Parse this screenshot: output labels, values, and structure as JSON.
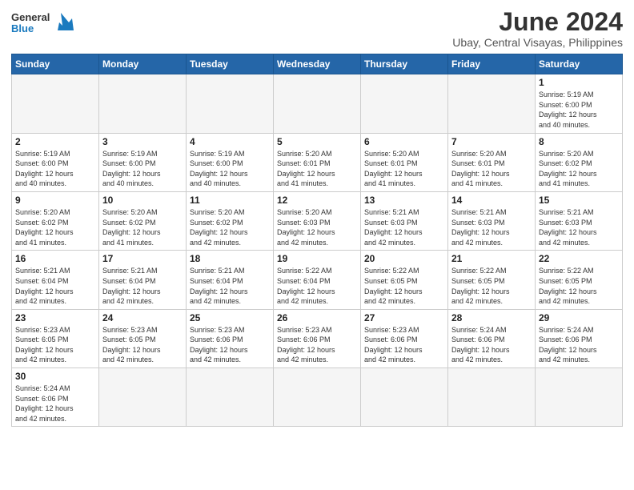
{
  "logo": {
    "text_general": "General",
    "text_blue": "Blue"
  },
  "title": "June 2024",
  "subtitle": "Ubay, Central Visayas, Philippines",
  "days_header": [
    "Sunday",
    "Monday",
    "Tuesday",
    "Wednesday",
    "Thursday",
    "Friday",
    "Saturday"
  ],
  "weeks": [
    [
      {
        "num": "",
        "info": "",
        "empty": true
      },
      {
        "num": "",
        "info": "",
        "empty": true
      },
      {
        "num": "",
        "info": "",
        "empty": true
      },
      {
        "num": "",
        "info": "",
        "empty": true
      },
      {
        "num": "",
        "info": "",
        "empty": true
      },
      {
        "num": "",
        "info": "",
        "empty": true
      },
      {
        "num": "1",
        "info": "Sunrise: 5:19 AM\nSunset: 6:00 PM\nDaylight: 12 hours\nand 40 minutes."
      }
    ],
    [
      {
        "num": "2",
        "info": "Sunrise: 5:19 AM\nSunset: 6:00 PM\nDaylight: 12 hours\nand 40 minutes."
      },
      {
        "num": "3",
        "info": "Sunrise: 5:19 AM\nSunset: 6:00 PM\nDaylight: 12 hours\nand 40 minutes."
      },
      {
        "num": "4",
        "info": "Sunrise: 5:19 AM\nSunset: 6:00 PM\nDaylight: 12 hours\nand 40 minutes."
      },
      {
        "num": "5",
        "info": "Sunrise: 5:20 AM\nSunset: 6:01 PM\nDaylight: 12 hours\nand 41 minutes."
      },
      {
        "num": "6",
        "info": "Sunrise: 5:20 AM\nSunset: 6:01 PM\nDaylight: 12 hours\nand 41 minutes."
      },
      {
        "num": "7",
        "info": "Sunrise: 5:20 AM\nSunset: 6:01 PM\nDaylight: 12 hours\nand 41 minutes."
      },
      {
        "num": "8",
        "info": "Sunrise: 5:20 AM\nSunset: 6:02 PM\nDaylight: 12 hours\nand 41 minutes."
      }
    ],
    [
      {
        "num": "9",
        "info": "Sunrise: 5:20 AM\nSunset: 6:02 PM\nDaylight: 12 hours\nand 41 minutes."
      },
      {
        "num": "10",
        "info": "Sunrise: 5:20 AM\nSunset: 6:02 PM\nDaylight: 12 hours\nand 41 minutes."
      },
      {
        "num": "11",
        "info": "Sunrise: 5:20 AM\nSunset: 6:02 PM\nDaylight: 12 hours\nand 42 minutes."
      },
      {
        "num": "12",
        "info": "Sunrise: 5:20 AM\nSunset: 6:03 PM\nDaylight: 12 hours\nand 42 minutes."
      },
      {
        "num": "13",
        "info": "Sunrise: 5:21 AM\nSunset: 6:03 PM\nDaylight: 12 hours\nand 42 minutes."
      },
      {
        "num": "14",
        "info": "Sunrise: 5:21 AM\nSunset: 6:03 PM\nDaylight: 12 hours\nand 42 minutes."
      },
      {
        "num": "15",
        "info": "Sunrise: 5:21 AM\nSunset: 6:03 PM\nDaylight: 12 hours\nand 42 minutes."
      }
    ],
    [
      {
        "num": "16",
        "info": "Sunrise: 5:21 AM\nSunset: 6:04 PM\nDaylight: 12 hours\nand 42 minutes."
      },
      {
        "num": "17",
        "info": "Sunrise: 5:21 AM\nSunset: 6:04 PM\nDaylight: 12 hours\nand 42 minutes."
      },
      {
        "num": "18",
        "info": "Sunrise: 5:21 AM\nSunset: 6:04 PM\nDaylight: 12 hours\nand 42 minutes."
      },
      {
        "num": "19",
        "info": "Sunrise: 5:22 AM\nSunset: 6:04 PM\nDaylight: 12 hours\nand 42 minutes."
      },
      {
        "num": "20",
        "info": "Sunrise: 5:22 AM\nSunset: 6:05 PM\nDaylight: 12 hours\nand 42 minutes."
      },
      {
        "num": "21",
        "info": "Sunrise: 5:22 AM\nSunset: 6:05 PM\nDaylight: 12 hours\nand 42 minutes."
      },
      {
        "num": "22",
        "info": "Sunrise: 5:22 AM\nSunset: 6:05 PM\nDaylight: 12 hours\nand 42 minutes."
      }
    ],
    [
      {
        "num": "23",
        "info": "Sunrise: 5:23 AM\nSunset: 6:05 PM\nDaylight: 12 hours\nand 42 minutes."
      },
      {
        "num": "24",
        "info": "Sunrise: 5:23 AM\nSunset: 6:05 PM\nDaylight: 12 hours\nand 42 minutes."
      },
      {
        "num": "25",
        "info": "Sunrise: 5:23 AM\nSunset: 6:06 PM\nDaylight: 12 hours\nand 42 minutes."
      },
      {
        "num": "26",
        "info": "Sunrise: 5:23 AM\nSunset: 6:06 PM\nDaylight: 12 hours\nand 42 minutes."
      },
      {
        "num": "27",
        "info": "Sunrise: 5:23 AM\nSunset: 6:06 PM\nDaylight: 12 hours\nand 42 minutes."
      },
      {
        "num": "28",
        "info": "Sunrise: 5:24 AM\nSunset: 6:06 PM\nDaylight: 12 hours\nand 42 minutes."
      },
      {
        "num": "29",
        "info": "Sunrise: 5:24 AM\nSunset: 6:06 PM\nDaylight: 12 hours\nand 42 minutes."
      }
    ],
    [
      {
        "num": "30",
        "info": "Sunrise: 5:24 AM\nSunset: 6:06 PM\nDaylight: 12 hours\nand 42 minutes."
      },
      {
        "num": "",
        "info": "",
        "empty": true
      },
      {
        "num": "",
        "info": "",
        "empty": true
      },
      {
        "num": "",
        "info": "",
        "empty": true
      },
      {
        "num": "",
        "info": "",
        "empty": true
      },
      {
        "num": "",
        "info": "",
        "empty": true
      },
      {
        "num": "",
        "info": "",
        "empty": true
      }
    ]
  ]
}
